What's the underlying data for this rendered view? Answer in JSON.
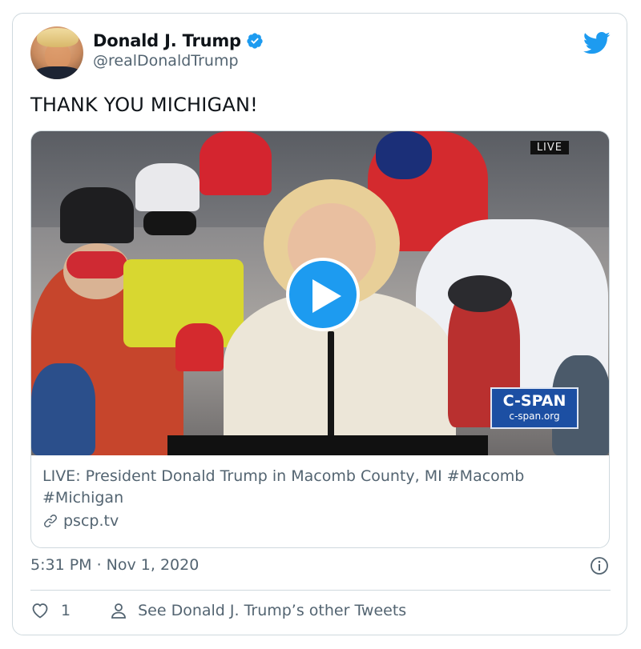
{
  "user": {
    "display_name": "Donald J. Trump",
    "handle": "@realDonaldTrump",
    "verified": true
  },
  "tweet": {
    "text": "THANK YOU MICHIGAN!",
    "timestamp": "5:31 PM · Nov 1, 2020"
  },
  "media": {
    "overlay_live": "LIVE",
    "overlay_network": "C-SPAN",
    "overlay_network_url": "c-span.org",
    "link_title": "LIVE: President Donald Trump in Macomb County, MI #Macomb #Michigan",
    "link_domain": "pscp.tv"
  },
  "actions": {
    "like_count": "1",
    "profile_link": "See Donald J. Trump’s other Tweets"
  },
  "colors": {
    "twitter_blue": "#1d9bf0",
    "secondary_text": "#536471",
    "border": "#cfd9de"
  },
  "icons": [
    "twitter-logo-icon",
    "verified-badge-icon",
    "play-icon",
    "link-icon",
    "info-icon",
    "heart-icon",
    "person-icon"
  ]
}
